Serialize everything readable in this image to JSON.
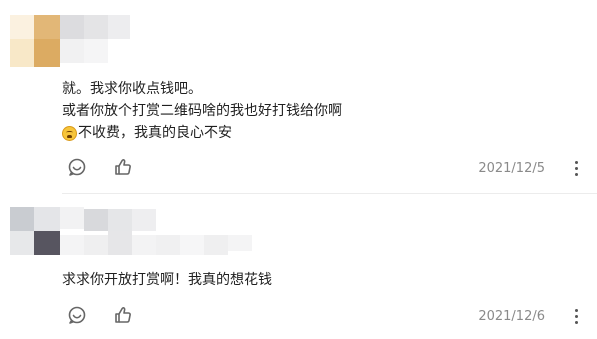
{
  "comments": [
    {
      "lines": [
        "就。我求你收点钱吧。",
        "或者你放个打赏二维码啥的我也好打钱给你啊",
        "不收费，我真的良心不安"
      ],
      "emoji_icon": "exhausted-face-emoji",
      "date": "2021/12/5",
      "icons": {
        "reply": "comment-bubble-icon",
        "like": "thumbs-up-icon",
        "more": "more-vertical-icon"
      }
    },
    {
      "lines": [
        "求求你开放打赏啊！我真的想花钱"
      ],
      "date": "2021/12/6",
      "icons": {
        "reply": "comment-bubble-icon",
        "like": "thumbs-up-icon",
        "more": "more-vertical-icon"
      }
    }
  ],
  "colors": {
    "text": "#1f1f1f",
    "date": "#8a8a8a",
    "icon": "#666666",
    "emoji": "#f7c53a"
  }
}
